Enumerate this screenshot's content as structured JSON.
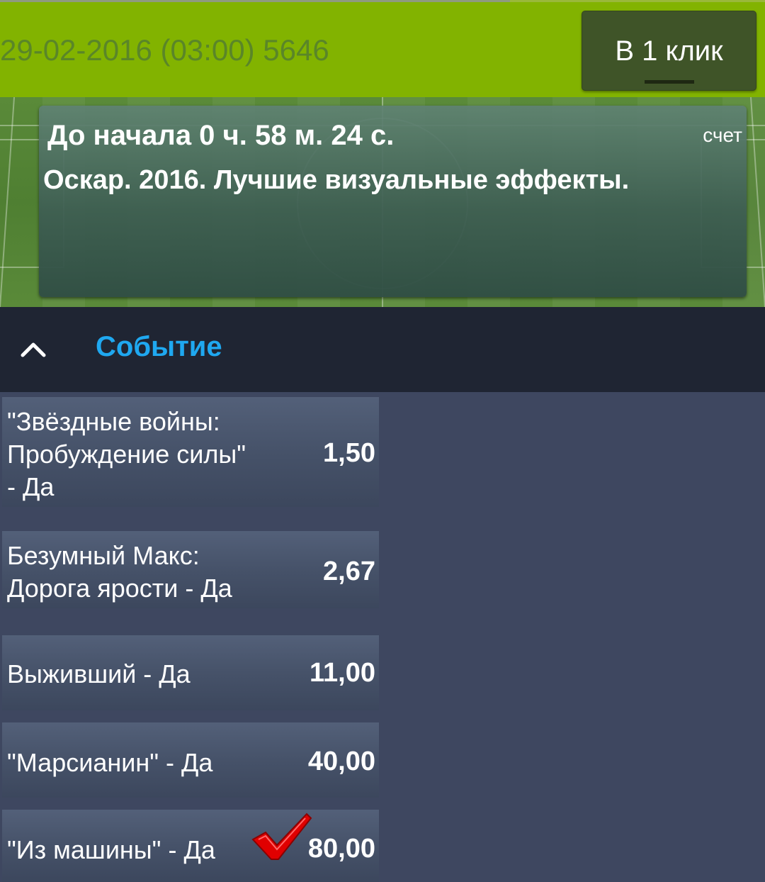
{
  "header": {
    "title": "29-02-2016 (03:00) 5646",
    "one_click_label": "В 1 клик"
  },
  "event_card": {
    "countdown": "До начала 0 ч. 58 м. 24 с.",
    "score_label": "счет",
    "event_name": "Оскар. 2016. Лучшие визуальные эффекты."
  },
  "section": {
    "title": "Событие",
    "collapse_icon": "chevron-up-icon"
  },
  "outcomes": [
    {
      "label_lines": [
        "\"Звёздные войны:",
        "Пробуждение силы\"",
        "- Да"
      ],
      "odds": "1,50",
      "selected": false
    },
    {
      "label_lines": [
        "Безумный Макс:",
        "Дорога ярости - Да"
      ],
      "odds": "2,67",
      "selected": false
    },
    {
      "label_lines": [
        "Выживший - Да"
      ],
      "odds": "11,00",
      "selected": false
    },
    {
      "label_lines": [
        "\"Марсианин\" - Да"
      ],
      "odds": "40,00",
      "selected": false
    },
    {
      "label_lines": [
        "\"Из машины\" - Да"
      ],
      "odds": "80,00",
      "selected": true,
      "mark_icon": "red-checkmark-icon"
    }
  ],
  "colors": {
    "header_green": "#82b300",
    "section_title_blue": "#1fa8f0",
    "page_background": "#3e4760",
    "checkmark_red": "#e00000"
  }
}
